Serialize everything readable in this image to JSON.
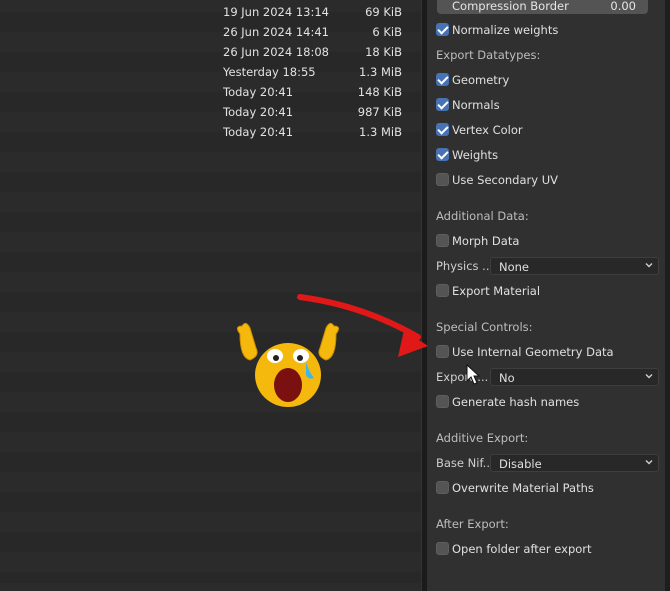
{
  "files": [
    {
      "date": "19 Jun 2024 13:14",
      "size": "69 KiB"
    },
    {
      "date": "26 Jun 2024 14:41",
      "size": "6 KiB"
    },
    {
      "date": "26 Jun 2024 18:08",
      "size": "18 KiB"
    },
    {
      "date": "Yesterday 18:55",
      "size": "1.3 MiB"
    },
    {
      "date": "Today 20:41",
      "size": "148 KiB"
    },
    {
      "date": "Today 20:41",
      "size": "987 KiB"
    },
    {
      "date": "Today 20:41",
      "size": "1.3 MiB"
    }
  ],
  "compression_border": {
    "label": "Compression Border",
    "value": "0.00"
  },
  "options": {
    "normalize_weights": "Normalize weights",
    "geometry": "Geometry",
    "normals": "Normals",
    "vertex_color": "Vertex Color",
    "weights": "Weights",
    "secondary_uv": "Use Secondary UV",
    "morph_data": "Morph Data",
    "export_material": "Export Material",
    "internal_geometry": "Use Internal Geometry Data",
    "hash_names": "Generate hash names",
    "overwrite_material_paths": "Overwrite Material Paths",
    "open_folder": "Open folder after export"
  },
  "sections": {
    "export_datatypes": "Export Datatypes:",
    "additional_data": "Additional Data:",
    "special_controls": "Special Controls:",
    "additive_export": "Additive Export:",
    "after_export": "After Export:"
  },
  "dropdowns": {
    "physics": {
      "label": "Physics ...",
      "value": "None"
    },
    "export": {
      "label": "Export ...",
      "value": "No"
    },
    "base_nif": {
      "label": "Base Nif...",
      "value": "Disable"
    }
  },
  "colors": {
    "accent": "#4772b3",
    "arrow": "#e01818",
    "emoji": "#f5b80c"
  },
  "icons": {
    "checkbox": "check-icon",
    "dropdown": "chevron-down-icon",
    "cursor": "mouse-pointer-icon",
    "emoji": "crying-face-emoji-icon",
    "arrow": "red-arrow-icon"
  }
}
